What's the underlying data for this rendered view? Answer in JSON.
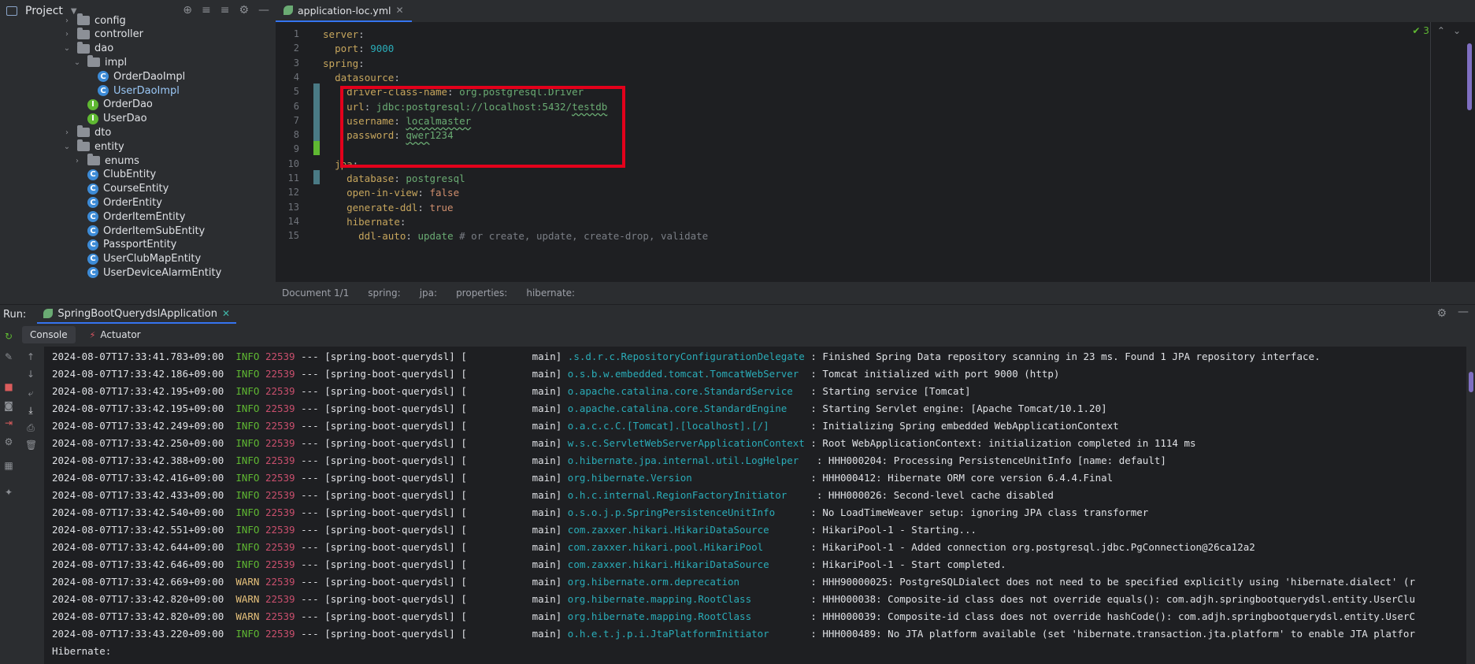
{
  "project": {
    "title": "Project",
    "tree": [
      {
        "label": "config",
        "type": "folder",
        "indent": 6,
        "open": false
      },
      {
        "label": "controller",
        "type": "folder",
        "indent": 6,
        "open": false
      },
      {
        "label": "dao",
        "type": "folder",
        "indent": 6,
        "open": true
      },
      {
        "label": "impl",
        "type": "folder",
        "indent": 7,
        "open": true
      },
      {
        "label": "OrderDaoImpl",
        "type": "class",
        "indent": 8
      },
      {
        "label": "UserDaoImpl",
        "type": "class",
        "indent": 8,
        "selected": true
      },
      {
        "label": "OrderDao",
        "type": "interface",
        "indent": 7
      },
      {
        "label": "UserDao",
        "type": "interface",
        "indent": 7
      },
      {
        "label": "dto",
        "type": "folder",
        "indent": 6,
        "open": false
      },
      {
        "label": "entity",
        "type": "folder",
        "indent": 6,
        "open": true
      },
      {
        "label": "enums",
        "type": "folder",
        "indent": 7,
        "open": false
      },
      {
        "label": "ClubEntity",
        "type": "class",
        "indent": 7
      },
      {
        "label": "CourseEntity",
        "type": "class",
        "indent": 7
      },
      {
        "label": "OrderEntity",
        "type": "class",
        "indent": 7
      },
      {
        "label": "OrderItemEntity",
        "type": "class",
        "indent": 7
      },
      {
        "label": "OrderItemSubEntity",
        "type": "class",
        "indent": 7
      },
      {
        "label": "PassportEntity",
        "type": "class",
        "indent": 7
      },
      {
        "label": "UserClubMapEntity",
        "type": "class",
        "indent": 7
      },
      {
        "label": "UserDeviceAlarmEntity",
        "type": "class",
        "indent": 7
      }
    ]
  },
  "editor": {
    "tab_label": "application-loc.yml",
    "problems_count": "3",
    "lines": [
      {
        "n": "1",
        "tokens": [
          [
            "k",
            "server"
          ],
          [
            "plain",
            ":"
          ]
        ]
      },
      {
        "n": "2",
        "tokens": [
          [
            "plain",
            "  "
          ],
          [
            "k",
            "port"
          ],
          [
            "plain",
            ": "
          ],
          [
            "num",
            "9000"
          ]
        ]
      },
      {
        "n": "3",
        "tokens": [
          [
            "k",
            "spring"
          ],
          [
            "plain",
            ":"
          ]
        ]
      },
      {
        "n": "4",
        "tokens": [
          [
            "plain",
            "  "
          ],
          [
            "k",
            "datasource"
          ],
          [
            "plain",
            ":"
          ]
        ]
      },
      {
        "n": "5",
        "tokens": [
          [
            "plain",
            "    "
          ],
          [
            "k",
            "driver-class-name"
          ],
          [
            "plain",
            ": "
          ],
          [
            "sv",
            "org.postgresql.Driver"
          ]
        ]
      },
      {
        "n": "6",
        "tokens": [
          [
            "plain",
            "    "
          ],
          [
            "k",
            "url"
          ],
          [
            "plain",
            ": "
          ],
          [
            "sv",
            "jdbc:postgresql://localhost:5432/"
          ],
          [
            "svu",
            "testdb"
          ]
        ]
      },
      {
        "n": "7",
        "tokens": [
          [
            "plain",
            "    "
          ],
          [
            "k",
            "username"
          ],
          [
            "plain",
            ": "
          ],
          [
            "svu",
            "localmaster"
          ]
        ]
      },
      {
        "n": "8",
        "tokens": [
          [
            "plain",
            "    "
          ],
          [
            "k",
            "password"
          ],
          [
            "plain",
            ": "
          ],
          [
            "svu",
            "qwer"
          ],
          [
            "sv",
            "1234"
          ]
        ]
      },
      {
        "n": "9",
        "tokens": []
      },
      {
        "n": "10",
        "tokens": [
          [
            "plain",
            "  "
          ],
          [
            "k",
            "jpa"
          ],
          [
            "plain",
            ":"
          ]
        ]
      },
      {
        "n": "11",
        "tokens": [
          [
            "plain",
            "    "
          ],
          [
            "k",
            "database"
          ],
          [
            "plain",
            ": "
          ],
          [
            "sv",
            "postgresql"
          ]
        ]
      },
      {
        "n": "12",
        "tokens": [
          [
            "plain",
            "    "
          ],
          [
            "k",
            "open-in-view"
          ],
          [
            "plain",
            ": "
          ],
          [
            "bool",
            "false"
          ]
        ]
      },
      {
        "n": "13",
        "tokens": [
          [
            "plain",
            "    "
          ],
          [
            "k",
            "generate-ddl"
          ],
          [
            "plain",
            ": "
          ],
          [
            "bool",
            "true"
          ]
        ]
      },
      {
        "n": "14",
        "tokens": [
          [
            "plain",
            "    "
          ],
          [
            "k",
            "hibernate"
          ],
          [
            "plain",
            ":"
          ]
        ]
      },
      {
        "n": "15",
        "tokens": [
          [
            "plain",
            "      "
          ],
          [
            "k",
            "ddl-auto"
          ],
          [
            "plain",
            ": "
          ],
          [
            "sv",
            "update"
          ],
          [
            "com",
            " # or create, update, create-drop, validate"
          ]
        ]
      }
    ],
    "breadcrumbs": [
      "Document 1/1",
      "spring:",
      "jpa:",
      "properties:",
      "hibernate:"
    ]
  },
  "run": {
    "label": "Run:",
    "tab_label": "SpringBootQuerydslApplication",
    "console_tab": "Console",
    "actuator_tab": "Actuator",
    "logs": [
      {
        "ts": "2024-08-07T17:33:41.783+09:00",
        "level": "INFO",
        "pid": "22539",
        "app": "--- [spring-boot-querydsl] [           main]",
        "logger": ".s.d.r.c.RepositoryConfigurationDelegate",
        "msg": " : Finished Spring Data repository scanning in 23 ms. Found 1 JPA repository interface."
      },
      {
        "ts": "2024-08-07T17:33:42.186+09:00",
        "level": "INFO",
        "pid": "22539",
        "app": "--- [spring-boot-querydsl] [           main]",
        "logger": "o.s.b.w.embedded.tomcat.TomcatWebServer ",
        "msg": " : Tomcat initialized with port 9000 (http)"
      },
      {
        "ts": "2024-08-07T17:33:42.195+09:00",
        "level": "INFO",
        "pid": "22539",
        "app": "--- [spring-boot-querydsl] [           main]",
        "logger": "o.apache.catalina.core.StandardService  ",
        "msg": " : Starting service [Tomcat]"
      },
      {
        "ts": "2024-08-07T17:33:42.195+09:00",
        "level": "INFO",
        "pid": "22539",
        "app": "--- [spring-boot-querydsl] [           main]",
        "logger": "o.apache.catalina.core.StandardEngine   ",
        "msg": " : Starting Servlet engine: [Apache Tomcat/10.1.20]"
      },
      {
        "ts": "2024-08-07T17:33:42.249+09:00",
        "level": "INFO",
        "pid": "22539",
        "app": "--- [spring-boot-querydsl] [           main]",
        "logger": "o.a.c.c.C.[Tomcat].[localhost].[/]      ",
        "msg": " : Initializing Spring embedded WebApplicationContext"
      },
      {
        "ts": "2024-08-07T17:33:42.250+09:00",
        "level": "INFO",
        "pid": "22539",
        "app": "--- [spring-boot-querydsl] [           main]",
        "logger": "w.s.c.ServletWebServerApplicationContext",
        "msg": " : Root WebApplicationContext: initialization completed in 1114 ms"
      },
      {
        "ts": "2024-08-07T17:33:42.388+09:00",
        "level": "INFO",
        "pid": "22539",
        "app": "--- [spring-boot-querydsl] [           main]",
        "logger": "o.hibernate.jpa.internal.util.LogHelper  ",
        "msg": " : HHH000204: Processing PersistenceUnitInfo [name: default]"
      },
      {
        "ts": "2024-08-07T17:33:42.416+09:00",
        "level": "INFO",
        "pid": "22539",
        "app": "--- [spring-boot-querydsl] [           main]",
        "logger": "org.hibernate.Version                   ",
        "msg": " : HHH000412: Hibernate ORM core version 6.4.4.Final"
      },
      {
        "ts": "2024-08-07T17:33:42.433+09:00",
        "level": "INFO",
        "pid": "22539",
        "app": "--- [spring-boot-querydsl] [           main]",
        "logger": "o.h.c.internal.RegionFactoryInitiator    ",
        "msg": " : HHH000026: Second-level cache disabled"
      },
      {
        "ts": "2024-08-07T17:33:42.540+09:00",
        "level": "INFO",
        "pid": "22539",
        "app": "--- [spring-boot-querydsl] [           main]",
        "logger": "o.s.o.j.p.SpringPersistenceUnitInfo     ",
        "msg": " : No LoadTimeWeaver setup: ignoring JPA class transformer"
      },
      {
        "ts": "2024-08-07T17:33:42.551+09:00",
        "level": "INFO",
        "pid": "22539",
        "app": "--- [spring-boot-querydsl] [           main]",
        "logger": "com.zaxxer.hikari.HikariDataSource      ",
        "msg": " : HikariPool-1 - Starting..."
      },
      {
        "ts": "2024-08-07T17:33:42.644+09:00",
        "level": "INFO",
        "pid": "22539",
        "app": "--- [spring-boot-querydsl] [           main]",
        "logger": "com.zaxxer.hikari.pool.HikariPool       ",
        "msg": " : HikariPool-1 - Added connection org.postgresql.jdbc.PgConnection@26ca12a2"
      },
      {
        "ts": "2024-08-07T17:33:42.646+09:00",
        "level": "INFO",
        "pid": "22539",
        "app": "--- [spring-boot-querydsl] [           main]",
        "logger": "com.zaxxer.hikari.HikariDataSource      ",
        "msg": " : HikariPool-1 - Start completed."
      },
      {
        "ts": "2024-08-07T17:33:42.669+09:00",
        "level": "WARN",
        "pid": "22539",
        "app": "--- [spring-boot-querydsl] [           main]",
        "logger": "org.hibernate.orm.deprecation           ",
        "msg": " : HHH90000025: PostgreSQLDialect does not need to be specified explicitly using 'hibernate.dialect' (r"
      },
      {
        "ts": "2024-08-07T17:33:42.820+09:00",
        "level": "WARN",
        "pid": "22539",
        "app": "--- [spring-boot-querydsl] [           main]",
        "logger": "org.hibernate.mapping.RootClass         ",
        "msg": " : HHH000038: Composite-id class does not override equals(): com.adjh.springbootquerydsl.entity.UserClu"
      },
      {
        "ts": "2024-08-07T17:33:42.820+09:00",
        "level": "WARN",
        "pid": "22539",
        "app": "--- [spring-boot-querydsl] [           main]",
        "logger": "org.hibernate.mapping.RootClass         ",
        "msg": " : HHH000039: Composite-id class does not override hashCode(): com.adjh.springbootquerydsl.entity.UserC"
      },
      {
        "ts": "2024-08-07T17:33:43.220+09:00",
        "level": "INFO",
        "pid": "22539",
        "app": "--- [spring-boot-querydsl] [           main]",
        "logger": "o.h.e.t.j.p.i.JtaPlatformInitiator      ",
        "msg": " : HHH000489: No JTA platform available (set 'hibernate.transaction.jta.platform' to enable JTA platfor"
      }
    ],
    "trailing": "Hibernate:"
  }
}
